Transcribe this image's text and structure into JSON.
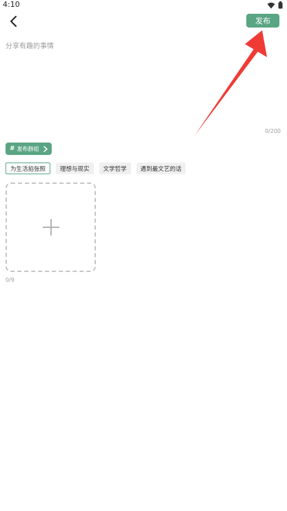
{
  "status_bar": {
    "time": "4:10"
  },
  "header": {
    "publish_label": "发布"
  },
  "editor": {
    "placeholder": "分享有趣的事情",
    "char_count": "0/200"
  },
  "group_button": {
    "label": "发布群组"
  },
  "tags": [
    {
      "label": "为生活拍张照",
      "active": true
    },
    {
      "label": "理想与现实",
      "active": false
    },
    {
      "label": "文学哲学",
      "active": false
    },
    {
      "label": "遇到最文艺的话",
      "active": false
    }
  ],
  "images": {
    "count_label": "0/9"
  },
  "colors": {
    "accent": "#5aa583",
    "annotation_arrow": "#ef3b36"
  }
}
